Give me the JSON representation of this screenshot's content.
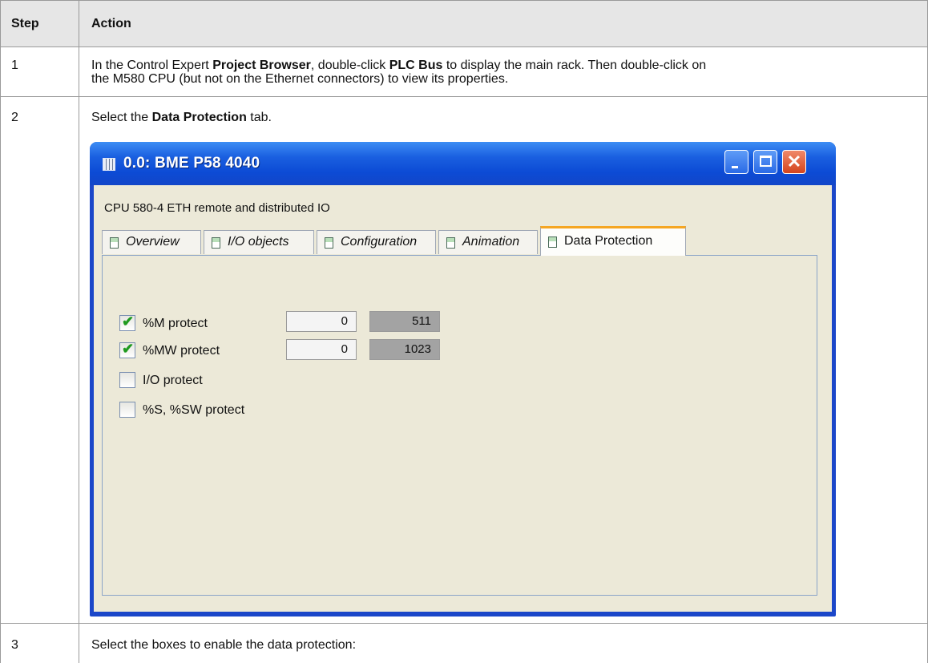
{
  "table": {
    "headers": {
      "step": "Step",
      "action": "Action"
    },
    "rows": [
      {
        "step": "1",
        "action": {
          "p1": "In the Control Expert ",
          "b1": "Project Browser",
          "p2": ", double-click ",
          "b2": "PLC Bus",
          "p3": " to display the main rack. Then double-click on",
          "line2": "the M580 CPU (but not on the Ethernet connectors) to view its properties."
        }
      },
      {
        "step": "2",
        "action": {
          "p1": "Select the ",
          "b1": "Data Protection",
          "p2": " tab."
        }
      },
      {
        "step": "3",
        "action": {
          "p1": "Select the boxes to enable the data protection:"
        }
      }
    ]
  },
  "dialog": {
    "title": "0.0: BME P58 4040",
    "description": "CPU 580-4 ETH remote and distributed IO",
    "tabs": [
      "Overview",
      "I/O objects",
      "Configuration",
      "Animation",
      "Data Protection"
    ],
    "active_tab": "Data Protection",
    "options": [
      {
        "label": "%M protect",
        "checked": true,
        "start": "0",
        "end": "511"
      },
      {
        "label": "%MW protect",
        "checked": true,
        "start": "0",
        "end": "1023"
      },
      {
        "label": "I/O protect",
        "checked": false
      },
      {
        "label": "%S, %SW protect",
        "checked": false
      }
    ],
    "colors": {
      "titlebar": "#1a5fe0",
      "client": "#ece9d8",
      "active_tab_accent": "#f5a623",
      "check": "#1f9a1f"
    }
  }
}
